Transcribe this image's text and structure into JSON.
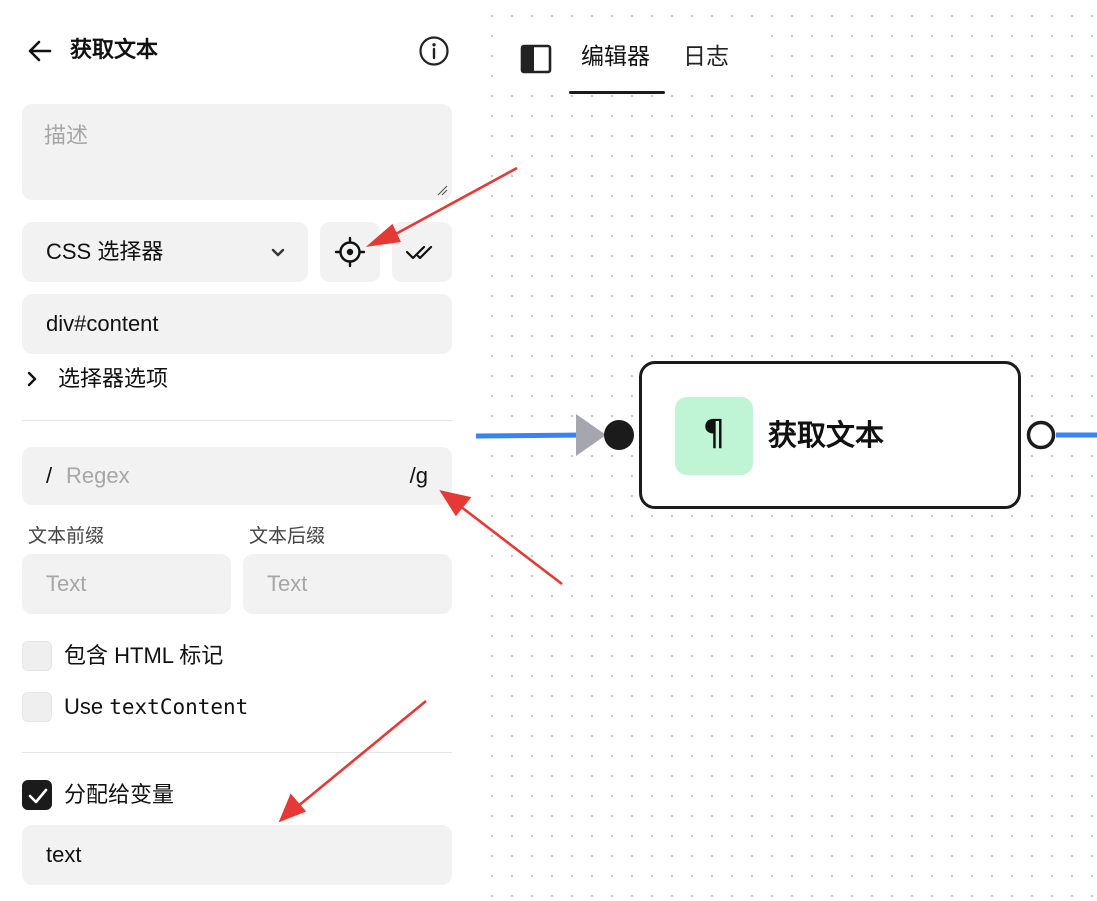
{
  "panel": {
    "title": "获取文本",
    "description_placeholder": "描述",
    "selector_type": "CSS 选择器",
    "selector_value": "div#content",
    "selector_options_label": "选择器选项",
    "regex": {
      "prefix": "/",
      "placeholder": "Regex",
      "flags": "/g"
    },
    "text_prefix": {
      "label": "文本前缀",
      "placeholder": "Text"
    },
    "text_suffix": {
      "label": "文本后缀",
      "placeholder": "Text"
    },
    "include_html": {
      "label": "包含 HTML 标记",
      "checked": false
    },
    "use_text_content": {
      "label_prefix": "Use",
      "label_code": "textContent",
      "checked": false
    },
    "assign_variable": {
      "label": "分配给变量",
      "checked": true
    },
    "variable_name": "text"
  },
  "tabs": {
    "items": [
      "编辑器",
      "日志"
    ],
    "active": "编辑器"
  },
  "node": {
    "title": "获取文本",
    "icon_glyph": "¶",
    "icon_name": "paragraph-icon",
    "icon_bg": "#bff5d4"
  },
  "colors": {
    "accent_edge": "#3b82f6",
    "annotation_arrow": "#e53935"
  }
}
